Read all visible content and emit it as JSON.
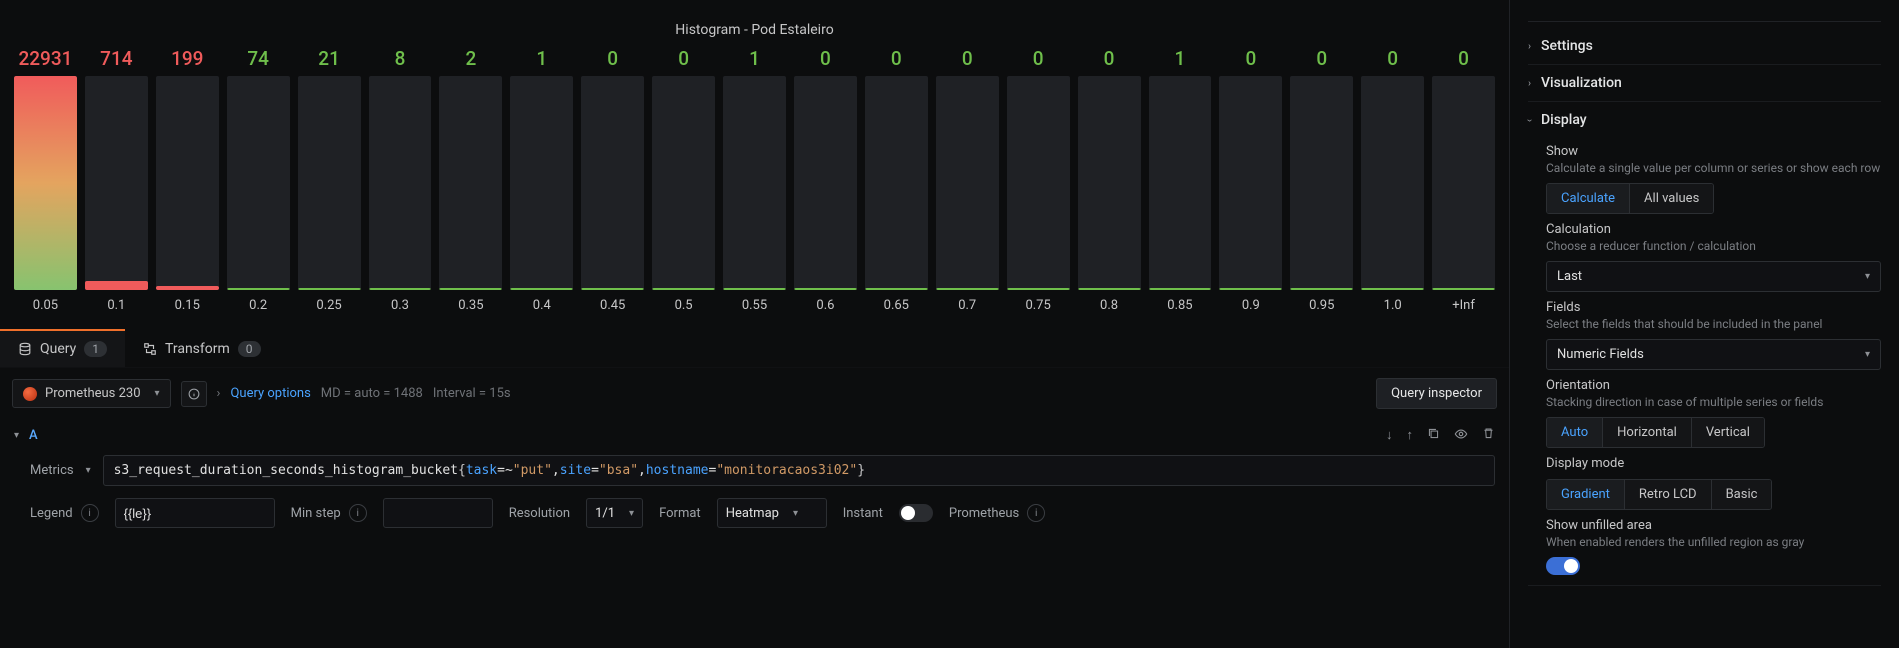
{
  "panel": {
    "title": "Histogram - Pod Estaleiro"
  },
  "chart_data": {
    "type": "bar",
    "categories": [
      "0.05",
      "0.1",
      "0.15",
      "0.2",
      "0.25",
      "0.3",
      "0.35",
      "0.4",
      "0.45",
      "0.5",
      "0.55",
      "0.6",
      "0.65",
      "0.7",
      "0.75",
      "0.8",
      "0.85",
      "0.9",
      "0.95",
      "1.0",
      "+Inf"
    ],
    "values": [
      22931,
      714,
      199,
      74,
      21,
      8,
      2,
      1,
      0,
      0,
      1,
      0,
      0,
      0,
      0,
      0,
      1,
      0,
      0,
      0,
      0
    ],
    "title": "Histogram - Pod Estaleiro",
    "xlabel": "",
    "ylabel": "",
    "ylim": [
      0,
      22931
    ]
  },
  "bars": [
    {
      "value": "22931",
      "tick": "0.05",
      "h": 100,
      "color": "#f05b5b",
      "fill": "linear-gradient(to top,#87c36f,#e4a45f,#f05b5b)"
    },
    {
      "value": "714",
      "tick": "0.1",
      "h": 4,
      "color": "#f05b5b",
      "fill": "#f05b5b"
    },
    {
      "value": "199",
      "tick": "0.15",
      "h": 2,
      "color": "#f05b5b",
      "fill": "#f05b5b"
    },
    {
      "value": "74",
      "tick": "0.2",
      "h": 1,
      "color": "#6fbf4b",
      "fill": "#6fbf4b"
    },
    {
      "value": "21",
      "tick": "0.25",
      "h": 1,
      "color": "#6fbf4b",
      "fill": "#6fbf4b"
    },
    {
      "value": "8",
      "tick": "0.3",
      "h": 1,
      "color": "#6fbf4b",
      "fill": "#6fbf4b"
    },
    {
      "value": "2",
      "tick": "0.35",
      "h": 1,
      "color": "#6fbf4b",
      "fill": "#6fbf4b"
    },
    {
      "value": "1",
      "tick": "0.4",
      "h": 1,
      "color": "#6fbf4b",
      "fill": "#6fbf4b"
    },
    {
      "value": "0",
      "tick": "0.45",
      "h": 1,
      "color": "#6fbf4b",
      "fill": "#6fbf4b"
    },
    {
      "value": "0",
      "tick": "0.5",
      "h": 1,
      "color": "#6fbf4b",
      "fill": "#6fbf4b"
    },
    {
      "value": "1",
      "tick": "0.55",
      "h": 1,
      "color": "#6fbf4b",
      "fill": "#6fbf4b"
    },
    {
      "value": "0",
      "tick": "0.6",
      "h": 1,
      "color": "#6fbf4b",
      "fill": "#6fbf4b"
    },
    {
      "value": "0",
      "tick": "0.65",
      "h": 1,
      "color": "#6fbf4b",
      "fill": "#6fbf4b"
    },
    {
      "value": "0",
      "tick": "0.7",
      "h": 1,
      "color": "#6fbf4b",
      "fill": "#6fbf4b"
    },
    {
      "value": "0",
      "tick": "0.75",
      "h": 1,
      "color": "#6fbf4b",
      "fill": "#6fbf4b"
    },
    {
      "value": "0",
      "tick": "0.8",
      "h": 1,
      "color": "#6fbf4b",
      "fill": "#6fbf4b"
    },
    {
      "value": "1",
      "tick": "0.85",
      "h": 1,
      "color": "#6fbf4b",
      "fill": "#6fbf4b"
    },
    {
      "value": "0",
      "tick": "0.9",
      "h": 1,
      "color": "#6fbf4b",
      "fill": "#6fbf4b"
    },
    {
      "value": "0",
      "tick": "0.95",
      "h": 1,
      "color": "#6fbf4b",
      "fill": "#6fbf4b"
    },
    {
      "value": "0",
      "tick": "1.0",
      "h": 1,
      "color": "#6fbf4b",
      "fill": "#6fbf4b"
    },
    {
      "value": "0",
      "tick": "+Inf",
      "h": 1,
      "color": "#6fbf4b",
      "fill": "#6fbf4b"
    }
  ],
  "tabs": {
    "query_label": "Query",
    "query_count": "1",
    "transform_label": "Transform",
    "transform_count": "0"
  },
  "query": {
    "datasource": "Prometheus 230",
    "options_label": "Query options",
    "md": "MD = auto = 1488",
    "interval": "Interval = 15s",
    "inspector_label": "Query inspector",
    "a_label": "A",
    "metrics_label": "Metrics",
    "metric_name": "s3_request_duration_seconds_histogram_bucket",
    "task_key": "task",
    "task_op": "=~",
    "task_val": "\"put\"",
    "site_key": "site",
    "site_val": "\"bsa\"",
    "host_key": "hostname",
    "host_val": "\"monitoracaos3i02\"",
    "legend_label": "Legend",
    "legend_value": "{{le}}",
    "minstep_label": "Min step",
    "resolution_label": "Resolution",
    "resolution_value": "1/1",
    "format_label": "Format",
    "format_value": "Heatmap",
    "instant_label": "Instant",
    "prometheus_label": "Prometheus"
  },
  "side": {
    "settings_label": "Settings",
    "visualization_label": "Visualization",
    "display_label": "Display",
    "show_label": "Show",
    "show_desc": "Calculate a single value per column or series or show each row",
    "show_opts": [
      "Calculate",
      "All values"
    ],
    "calc_label": "Calculation",
    "calc_desc": "Choose a reducer function / calculation",
    "calc_value": "Last",
    "fields_label": "Fields",
    "fields_desc": "Select the fields that should be included in the panel",
    "fields_value": "Numeric Fields",
    "orient_label": "Orientation",
    "orient_desc": "Stacking direction in case of multiple series or fields",
    "orient_opts": [
      "Auto",
      "Horizontal",
      "Vertical"
    ],
    "mode_label": "Display mode",
    "mode_opts": [
      "Gradient",
      "Retro LCD",
      "Basic"
    ],
    "unfilled_label": "Show unfilled area",
    "unfilled_desc": "When enabled renders the unfilled region as gray"
  }
}
